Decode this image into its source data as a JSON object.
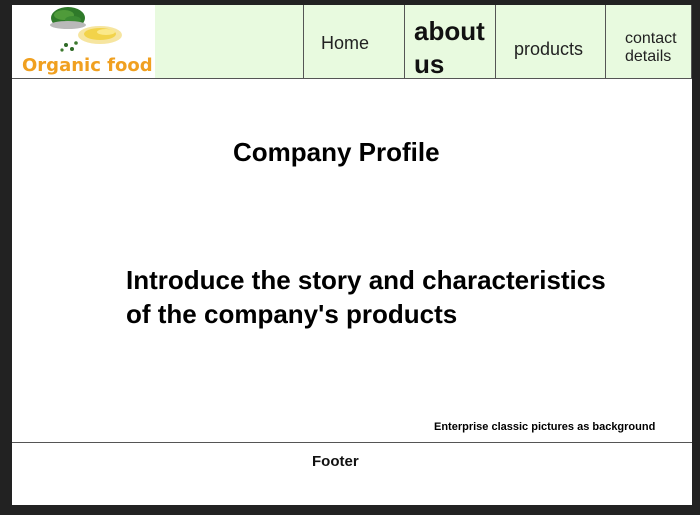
{
  "logo": {
    "text": "Organic food",
    "icon": "organic-food-logo-icon"
  },
  "nav": {
    "items": [
      {
        "label": ""
      },
      {
        "label": "Home"
      },
      {
        "label": "about us"
      },
      {
        "label": "products"
      },
      {
        "label": "contact details"
      }
    ]
  },
  "main": {
    "title": "Company Profile",
    "intro": "Introduce the story and characteristics of the company's products",
    "background_note": "Enterprise classic pictures as background"
  },
  "footer": {
    "label": "Footer"
  },
  "colors": {
    "nav_background": "#e8fadf",
    "logo_text": "#f0a020",
    "page_background": "#ffffff",
    "frame_background": "#222222"
  }
}
